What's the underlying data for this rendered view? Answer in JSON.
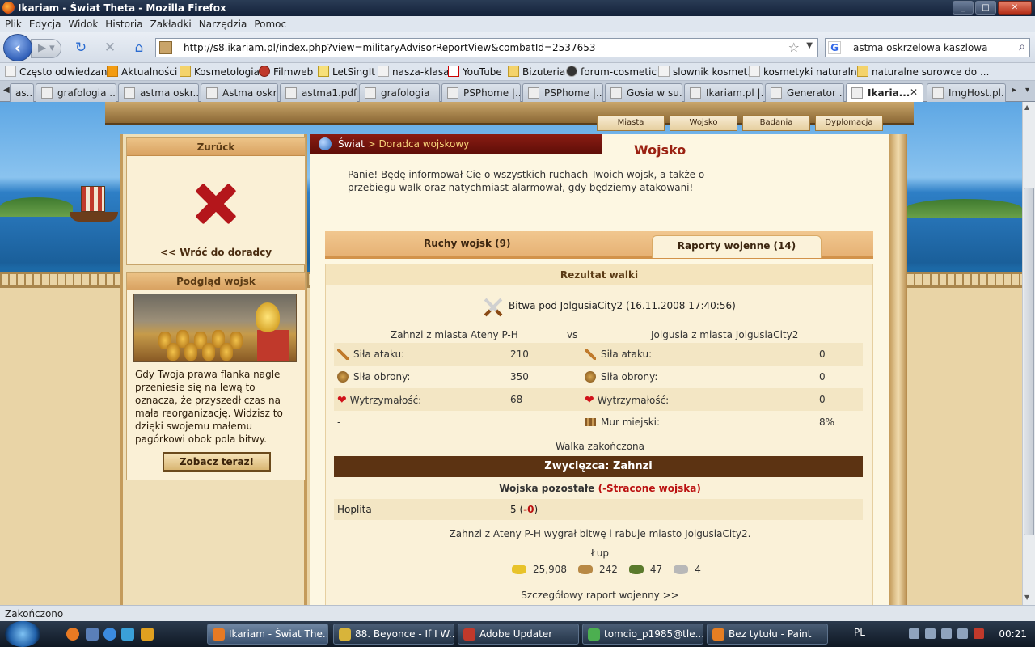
{
  "window": {
    "title": "Ikariam - Świat Theta - Mozilla Firefox"
  },
  "menu": [
    "Plik",
    "Edycja",
    "Widok",
    "Historia",
    "Zakładki",
    "Narzędzia",
    "Pomoc"
  ],
  "nav": {
    "url": "http://s8.ikariam.pl/index.php?view=militaryAdvisorReportView&combatId=2537653",
    "search": "astma oskrzelowa kaszlowa"
  },
  "bookmarks": [
    "Często odwiedzane",
    "Aktualności",
    "Kosmetologia",
    "Filmweb",
    "LetSingIt",
    "nasza-klasa",
    "YouTube",
    "Bizuteria",
    "forum-cosmetic",
    "slownik kosmet.",
    "kosmetyki naturalne",
    "naturalne surowce do ..."
  ],
  "tabs": [
    "as...",
    "grafologia ...",
    "astma oskr...",
    "Astma oskr...",
    "astma1.pdf...",
    "grafologia",
    "PSPhome |...",
    "PSPhome |...",
    "Gosia w su...",
    "Ikariam.pl |...",
    "Generator ...",
    "Ikaria...",
    "ImgHost.pl..."
  ],
  "game": {
    "nav": [
      "Miasta",
      "Wojsko",
      "Badania",
      "Dyplomacja"
    ],
    "back_box": {
      "header": "Zurück",
      "link": "<< Wróć do doradcy"
    },
    "army_box": {
      "header": "Podgląd wojsk",
      "text": "Gdy Twoja prawa flanka nagle przeniesie się na lewą to oznacza, że przyszedł czas na mała reorganizację. Widzisz to dzięki swojemu małemu pagórkowi obok pola bitwy.",
      "button": "Zobacz teraz!"
    },
    "breadcrumb": {
      "world": "Świat",
      "sep": " > ",
      "current": "Doradca wojskowy"
    },
    "title": "Wojsko",
    "intro": "Panie! Będę informował Cię o wszystkich ruchach Twoich wojsk, a także o przebiegu walk oraz natychmiast alarmował, gdy będziemy atakowani!",
    "tabs": {
      "movements": "Ruchy wojsk (9)",
      "reports": "Raporty wojenne (14)"
    },
    "report": {
      "header": "Rezultat walki",
      "battle": "Bitwa pod JolgusiaCity2 (16.11.2008 17:40:56)",
      "attacker": "Zahnzi z miasta Ateny P-H",
      "vs": "vs",
      "defender": "Jolgusia z miasta JolgusiaCity2",
      "rows": [
        {
          "l_label": "Siła ataku:",
          "l_val": "210",
          "r_label": "Siła ataku:",
          "r_val": "0"
        },
        {
          "l_label": "Siła obrony:",
          "l_val": "350",
          "r_label": "Siła obrony:",
          "r_val": "0"
        },
        {
          "l_label": "Wytrzymałość:",
          "l_val": "68",
          "r_label": "Wytrzymałość:",
          "r_val": "0"
        },
        {
          "l_label": "-",
          "l_val": "",
          "r_label": "Mur miejski:",
          "r_val": "8%"
        }
      ],
      "ended": "Walka zakończona",
      "winner": "Zwycięzca: Zahnzi",
      "remaining_label": "Wojska pozostałe",
      "lost_label": "(-Stracone wojska)",
      "unit_name": "Hoplita",
      "unit_count": "5",
      "unit_lost": "-0",
      "summary": "Zahnzi z Ateny P-H wygrał bitwę i rabuje miasto JolgusiaCity2.",
      "loot_label": "Łup",
      "loot": {
        "gold": "25,908",
        "wood": "242",
        "wine": "47",
        "marble": "4"
      },
      "detail_link": "Szczegółowy raport wojenny >>"
    }
  },
  "status": "Zakończono",
  "taskbar": {
    "tasks": [
      "Ikariam - Świat The...",
      "88. Beyonce - If I W...",
      "Adobe Updater",
      "tomcio_p1985@tle...",
      "Bez tytułu - Paint"
    ],
    "lang": "PL",
    "clock": "00:21"
  }
}
